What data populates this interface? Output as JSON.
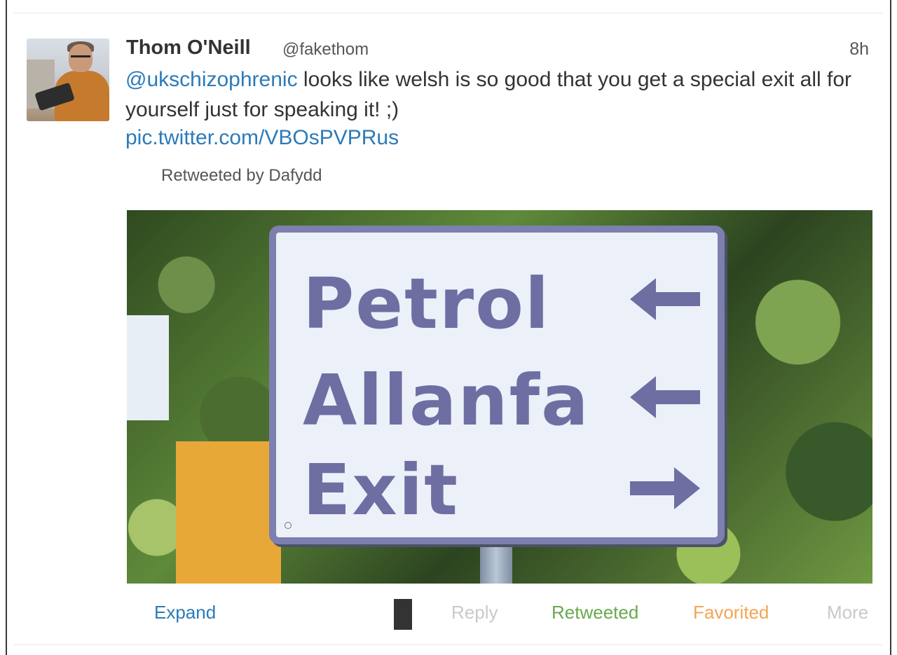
{
  "tweet": {
    "author_name": "Thom O'Neill",
    "author_handle": "@fakethom",
    "timestamp": "8h",
    "mention": "@ukschizophrenic",
    "text_after_mention": " looks like welsh is so good that you get a special exit all for yourself just for speaking it! ;)",
    "link": "pic.twitter.com/VBOsPVPRus",
    "retweeted_by": "Retweeted by Dafydd"
  },
  "media": {
    "sign_lines": [
      "Petrol",
      "Allanfa",
      "Exit"
    ],
    "arrows": [
      "left-arrow-icon",
      "left-arrow-icon",
      "right-arrow-icon"
    ]
  },
  "actions": {
    "expand": "Expand",
    "reply": "Reply",
    "retweeted": "Retweeted",
    "favorited": "Favorited",
    "more": "More"
  },
  "colors": {
    "link": "#2b7bb9",
    "retweeted": "#6aa84f",
    "favorited": "#f2a654",
    "muted": "#c9c9c9",
    "sign_text": "#6f6ea3"
  }
}
